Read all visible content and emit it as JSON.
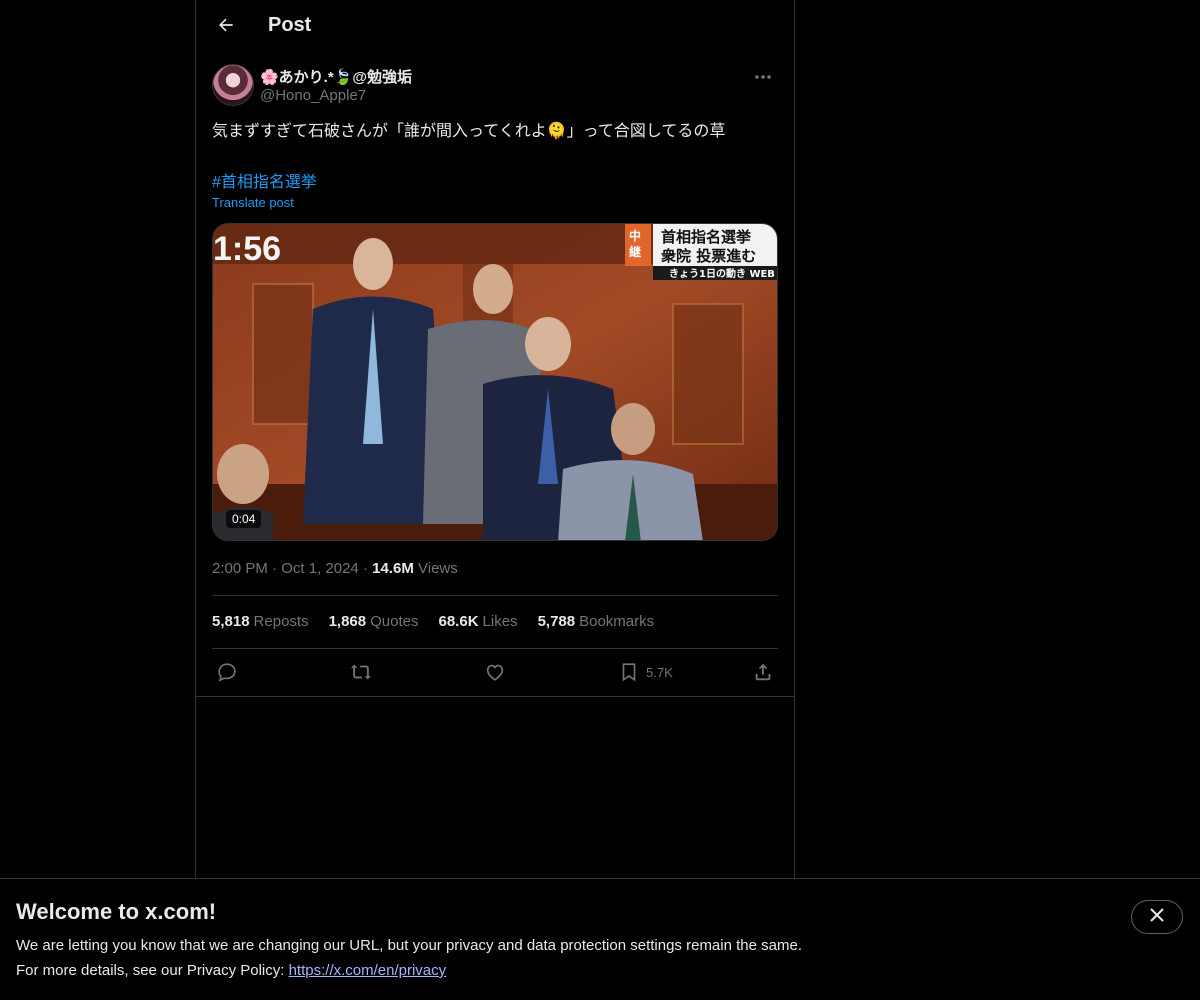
{
  "header": {
    "title": "Post"
  },
  "post": {
    "author": {
      "display_name": "🌸あかり.*🍃@勉強垢",
      "handle": "@Hono_Apple7"
    },
    "text": "気まずすぎて石破さんが「誰が間入ってくれよ🫠」って合図してるの草",
    "hashtag": "#首相指名選挙",
    "translate_label": "Translate post",
    "media": {
      "duration": "0:04",
      "overlay_clock": "1:56",
      "overlay_badge": "中継",
      "overlay_headline_1": "首相指名選挙",
      "overlay_headline_2": "衆院 投票進む",
      "overlay_subline": "きょう1日の動き WEB"
    },
    "time": "2:00 PM",
    "date": "Oct 1, 2024",
    "views_count": "14.6M",
    "views_label": "Views",
    "stats": {
      "reposts_count": "5,818",
      "reposts_label": "Reposts",
      "quotes_count": "1,868",
      "quotes_label": "Quotes",
      "likes_count": "68.6K",
      "likes_label": "Likes",
      "bookmarks_count": "5,788",
      "bookmarks_label": "Bookmarks"
    },
    "actions": {
      "bookmark_count": "5.7K"
    }
  },
  "banner": {
    "title": "Welcome to x.com!",
    "line1": "We are letting you know that we are changing our URL, but your privacy and data protection settings remain the same.",
    "line2_prefix": "For more details, see our Privacy Policy: ",
    "link": "https://x.com/en/privacy"
  },
  "colors": {
    "accent": "#1d9bf0",
    "text": "#e7e9ea",
    "muted": "#71767b",
    "border": "#2f3336"
  }
}
